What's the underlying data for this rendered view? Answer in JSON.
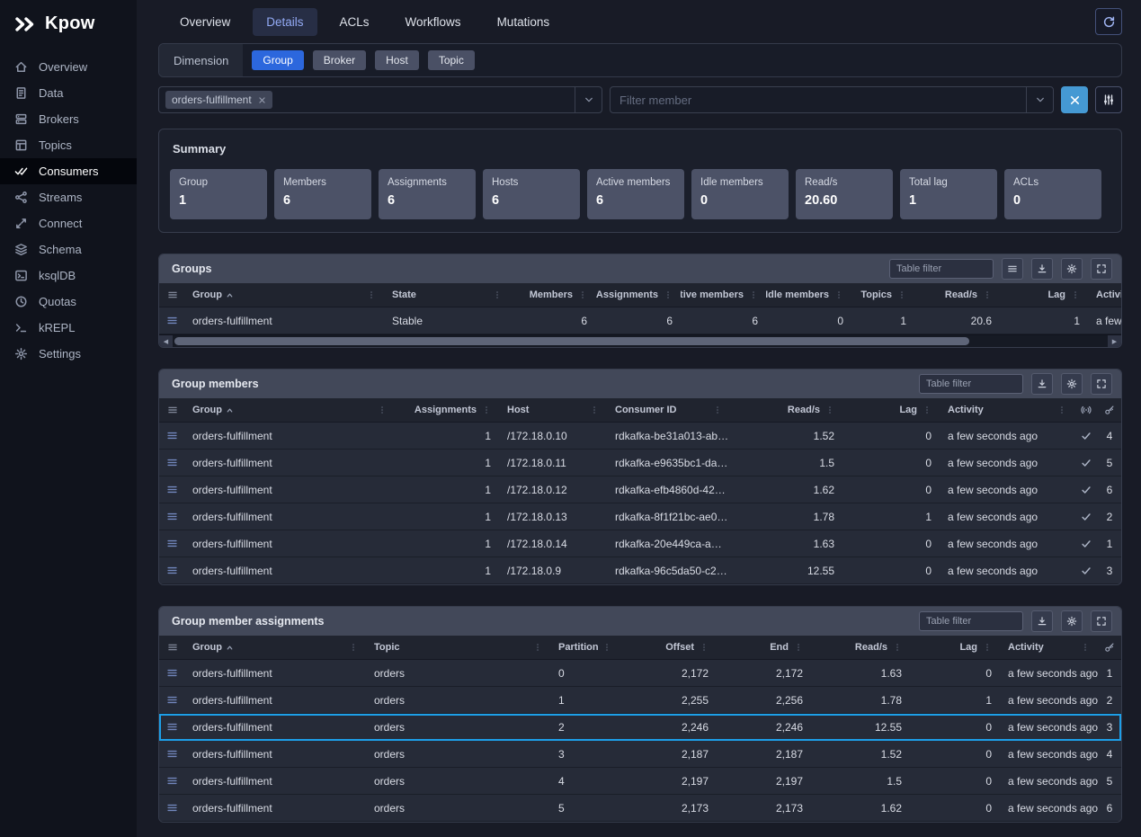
{
  "colors": {
    "accent": "#2c67dd",
    "row_highlight": "#1d9fe8",
    "clear_button": "#4599d3"
  },
  "brand": {
    "name": "Kpow"
  },
  "sidebar": {
    "items": [
      {
        "label": "Overview",
        "icon": "home-icon",
        "active": false
      },
      {
        "label": "Data",
        "icon": "data-icon",
        "active": false
      },
      {
        "label": "Brokers",
        "icon": "brokers-icon",
        "active": false
      },
      {
        "label": "Topics",
        "icon": "topics-icon",
        "active": false
      },
      {
        "label": "Consumers",
        "icon": "consumers-icon",
        "active": true
      },
      {
        "label": "Streams",
        "icon": "streams-icon",
        "active": false
      },
      {
        "label": "Connect",
        "icon": "connect-icon",
        "active": false
      },
      {
        "label": "Schema",
        "icon": "schema-icon",
        "active": false
      },
      {
        "label": "ksqlDB",
        "icon": "ksqldb-icon",
        "active": false
      },
      {
        "label": "Quotas",
        "icon": "quotas-icon",
        "active": false
      },
      {
        "label": "kREPL",
        "icon": "krepl-icon",
        "active": false
      },
      {
        "label": "Settings",
        "icon": "settings-icon",
        "active": false
      }
    ]
  },
  "tabs": [
    {
      "label": "Overview",
      "active": false
    },
    {
      "label": "Details",
      "active": true
    },
    {
      "label": "ACLs",
      "active": false
    },
    {
      "label": "Workflows",
      "active": false
    },
    {
      "label": "Mutations",
      "active": false
    }
  ],
  "dimension": {
    "label": "Dimension",
    "options": [
      {
        "label": "Group",
        "active": true
      },
      {
        "label": "Broker",
        "active": false
      },
      {
        "label": "Host",
        "active": false
      },
      {
        "label": "Topic",
        "active": false
      }
    ]
  },
  "filters": {
    "group_chip": "orders-fulfillment",
    "member_placeholder": "Filter member"
  },
  "summary": {
    "title": "Summary",
    "cards": [
      {
        "label": "Group",
        "value": "1"
      },
      {
        "label": "Members",
        "value": "6"
      },
      {
        "label": "Assignments",
        "value": "6"
      },
      {
        "label": "Hosts",
        "value": "6"
      },
      {
        "label": "Active members",
        "value": "6"
      },
      {
        "label": "Idle members",
        "value": "0"
      },
      {
        "label": "Read/s",
        "value": "20.60"
      },
      {
        "label": "Total lag",
        "value": "1"
      },
      {
        "label": "ACLs",
        "value": "0"
      }
    ]
  },
  "groups": {
    "title": "Groups",
    "filter_placeholder": "Table filter",
    "tools": [
      {
        "icon": "menu-icon"
      },
      {
        "icon": "download-icon"
      },
      {
        "icon": "gear-icon"
      },
      {
        "icon": "expand-icon"
      }
    ],
    "columns": [
      {
        "label": "Group",
        "sorted": true
      },
      {
        "label": "State"
      },
      {
        "label": "Members",
        "right": true
      },
      {
        "label": "Assignments",
        "right": true
      },
      {
        "label": "Active members",
        "right": true
      },
      {
        "label": "Idle members",
        "right": true
      },
      {
        "label": "Topics",
        "right": true
      },
      {
        "label": "Read/s",
        "right": true
      },
      {
        "label": "Lag",
        "right": true
      },
      {
        "label": "Activity"
      }
    ],
    "rows": [
      {
        "group": "orders-fulfillment",
        "state": "Stable",
        "members": "6",
        "assignments": "6",
        "active_members": "6",
        "idle_members": "0",
        "topics": "1",
        "reads": "20.6",
        "lag": "1",
        "activity": "a few seconds ago"
      }
    ]
  },
  "members": {
    "title": "Group members",
    "filter_placeholder": "Table filter",
    "tools": [
      {
        "icon": "download-icon"
      },
      {
        "icon": "gear-icon"
      },
      {
        "icon": "expand-icon"
      }
    ],
    "columns": [
      {
        "label": "Group",
        "sorted": true
      },
      {
        "label": "Assignments",
        "right": true
      },
      {
        "label": "Host"
      },
      {
        "label": "Consumer ID"
      },
      {
        "label": "Read/s",
        "right": true
      },
      {
        "label": "Lag",
        "right": true
      },
      {
        "label": "Activity"
      }
    ],
    "rows": [
      {
        "group": "orders-fulfillment",
        "assignments": "1",
        "host": "/172.18.0.10",
        "consumer_id": "rdkafka-be31a013-ab…",
        "reads": "1.52",
        "lag": "0",
        "activity": "a few seconds ago",
        "active": true,
        "member_no": "4"
      },
      {
        "group": "orders-fulfillment",
        "assignments": "1",
        "host": "/172.18.0.11",
        "consumer_id": "rdkafka-e9635bc1-da…",
        "reads": "1.5",
        "lag": "0",
        "activity": "a few seconds ago",
        "active": true,
        "member_no": "5"
      },
      {
        "group": "orders-fulfillment",
        "assignments": "1",
        "host": "/172.18.0.12",
        "consumer_id": "rdkafka-efb4860d-42…",
        "reads": "1.62",
        "lag": "0",
        "activity": "a few seconds ago",
        "active": true,
        "member_no": "6"
      },
      {
        "group": "orders-fulfillment",
        "assignments": "1",
        "host": "/172.18.0.13",
        "consumer_id": "rdkafka-8f1f21bc-ae0…",
        "reads": "1.78",
        "lag": "1",
        "activity": "a few seconds ago",
        "active": true,
        "member_no": "2"
      },
      {
        "group": "orders-fulfillment",
        "assignments": "1",
        "host": "/172.18.0.14",
        "consumer_id": "rdkafka-20e449ca-a…",
        "reads": "1.63",
        "lag": "0",
        "activity": "a few seconds ago",
        "active": true,
        "member_no": "1"
      },
      {
        "group": "orders-fulfillment",
        "assignments": "1",
        "host": "/172.18.0.9",
        "consumer_id": "rdkafka-96c5da50-c2…",
        "reads": "12.55",
        "lag": "0",
        "activity": "a few seconds ago",
        "active": true,
        "member_no": "3"
      }
    ]
  },
  "assignments": {
    "title": "Group member assignments",
    "filter_placeholder": "Table filter",
    "tools": [
      {
        "icon": "download-icon"
      },
      {
        "icon": "gear-icon"
      },
      {
        "icon": "expand-icon"
      }
    ],
    "columns": [
      {
        "label": "Group",
        "sorted": true
      },
      {
        "label": "Topic"
      },
      {
        "label": "Partition"
      },
      {
        "label": "Offset",
        "right": true
      },
      {
        "label": "End",
        "right": true
      },
      {
        "label": "Read/s",
        "right": true
      },
      {
        "label": "Lag",
        "right": true
      },
      {
        "label": "Activity"
      }
    ],
    "rows": [
      {
        "group": "orders-fulfillment",
        "topic": "orders",
        "partition": "0",
        "offset": "2,172",
        "end": "2,172",
        "reads": "1.63",
        "lag": "0",
        "activity": "a few seconds ago",
        "member_no": "1",
        "highlighted": false
      },
      {
        "group": "orders-fulfillment",
        "topic": "orders",
        "partition": "1",
        "offset": "2,255",
        "end": "2,256",
        "reads": "1.78",
        "lag": "1",
        "activity": "a few seconds ago",
        "member_no": "2",
        "highlighted": false
      },
      {
        "group": "orders-fulfillment",
        "topic": "orders",
        "partition": "2",
        "offset": "2,246",
        "end": "2,246",
        "reads": "12.55",
        "lag": "0",
        "activity": "a few seconds ago",
        "member_no": "3",
        "highlighted": true
      },
      {
        "group": "orders-fulfillment",
        "topic": "orders",
        "partition": "3",
        "offset": "2,187",
        "end": "2,187",
        "reads": "1.52",
        "lag": "0",
        "activity": "a few seconds ago",
        "member_no": "4",
        "highlighted": false
      },
      {
        "group": "orders-fulfillment",
        "topic": "orders",
        "partition": "4",
        "offset": "2,197",
        "end": "2,197",
        "reads": "1.5",
        "lag": "0",
        "activity": "a few seconds ago",
        "member_no": "5",
        "highlighted": false
      },
      {
        "group": "orders-fulfillment",
        "topic": "orders",
        "partition": "5",
        "offset": "2,173",
        "end": "2,173",
        "reads": "1.62",
        "lag": "0",
        "activity": "a few seconds ago",
        "member_no": "6",
        "highlighted": false
      }
    ]
  }
}
